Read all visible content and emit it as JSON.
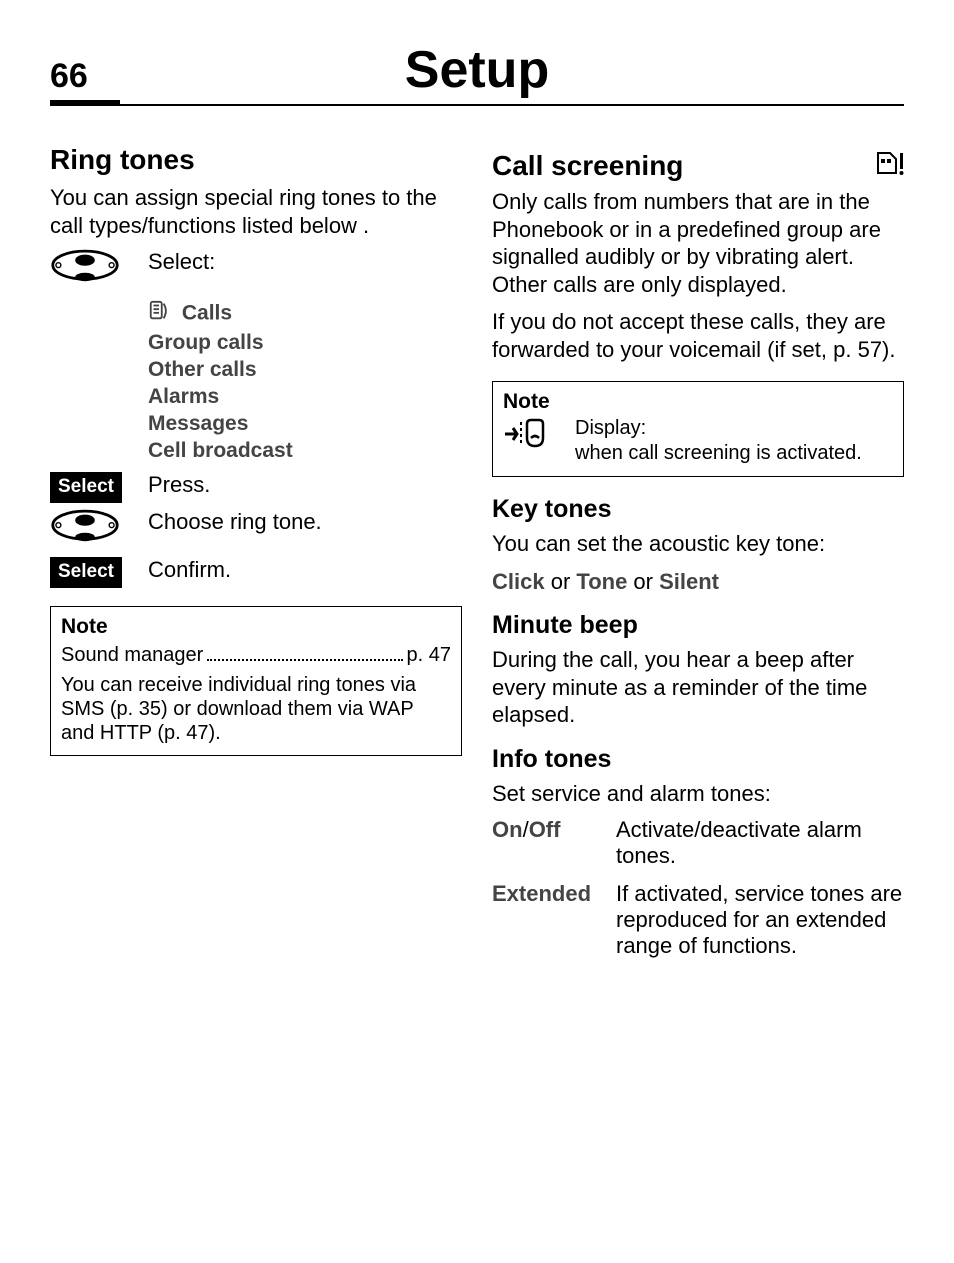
{
  "page": {
    "number": "66",
    "title": "Setup"
  },
  "left": {
    "ring_tones": {
      "heading": "Ring tones",
      "intro": "You can assign special ring tones to the call types/functions listed below .",
      "select_text": "Select:",
      "options": {
        "calls": "Calls",
        "group": "Group calls",
        "other": "Other calls",
        "alarms": "Alarms",
        "messages": "Messages",
        "cell": "Cell broadcast"
      },
      "softkey_select": "Select",
      "press_text": "Press.",
      "choose_text": "Choose ring tone.",
      "confirm_text": "Confirm."
    },
    "note": {
      "title": "Note",
      "sm_left": "Sound manager",
      "sm_right": "p. 47",
      "body": "You can receive individual ring tones via SMS (p. 35) or download them via WAP and HTTP (p. 47)."
    }
  },
  "right": {
    "call_screening": {
      "heading": "Call screening",
      "p1": "Only calls from numbers that are in the Phonebook or in a predefined group are signalled audibly or by vibrating alert. Other calls are only displayed.",
      "p2": "If you do not accept these calls, they are forwarded to your voicemail (if set, p. 57).",
      "note_title": "Note",
      "note_body_line1": "Display:",
      "note_body_line2": "when call screening is activated."
    },
    "key_tones": {
      "heading": "Key tones",
      "p": "You can set the acoustic key tone:",
      "opts": {
        "click": "Click",
        "or1": " or ",
        "tone": "Tone",
        "or2": " or ",
        "silent": "Silent"
      }
    },
    "minute_beep": {
      "heading": "Minute beep",
      "p": "During the call, you hear a beep after every minute as a reminder of the time elapsed."
    },
    "info_tones": {
      "heading": "Info tones",
      "p": "Set service and alarm tones:",
      "rows": {
        "onoff_k_on": "On",
        "onoff_k_sep": "/",
        "onoff_k_off": "Off",
        "onoff_v": "Activate/deactivate alarm tones.",
        "ext_k": "Extended",
        "ext_v": "If activated, service tones are reproduced for an extended range of functions."
      }
    }
  },
  "icons": {
    "rocker": "rocker-icon",
    "calls": "calls-icon",
    "sim_service": "sim-service-icon",
    "call_filter": "call-filter-icon"
  }
}
